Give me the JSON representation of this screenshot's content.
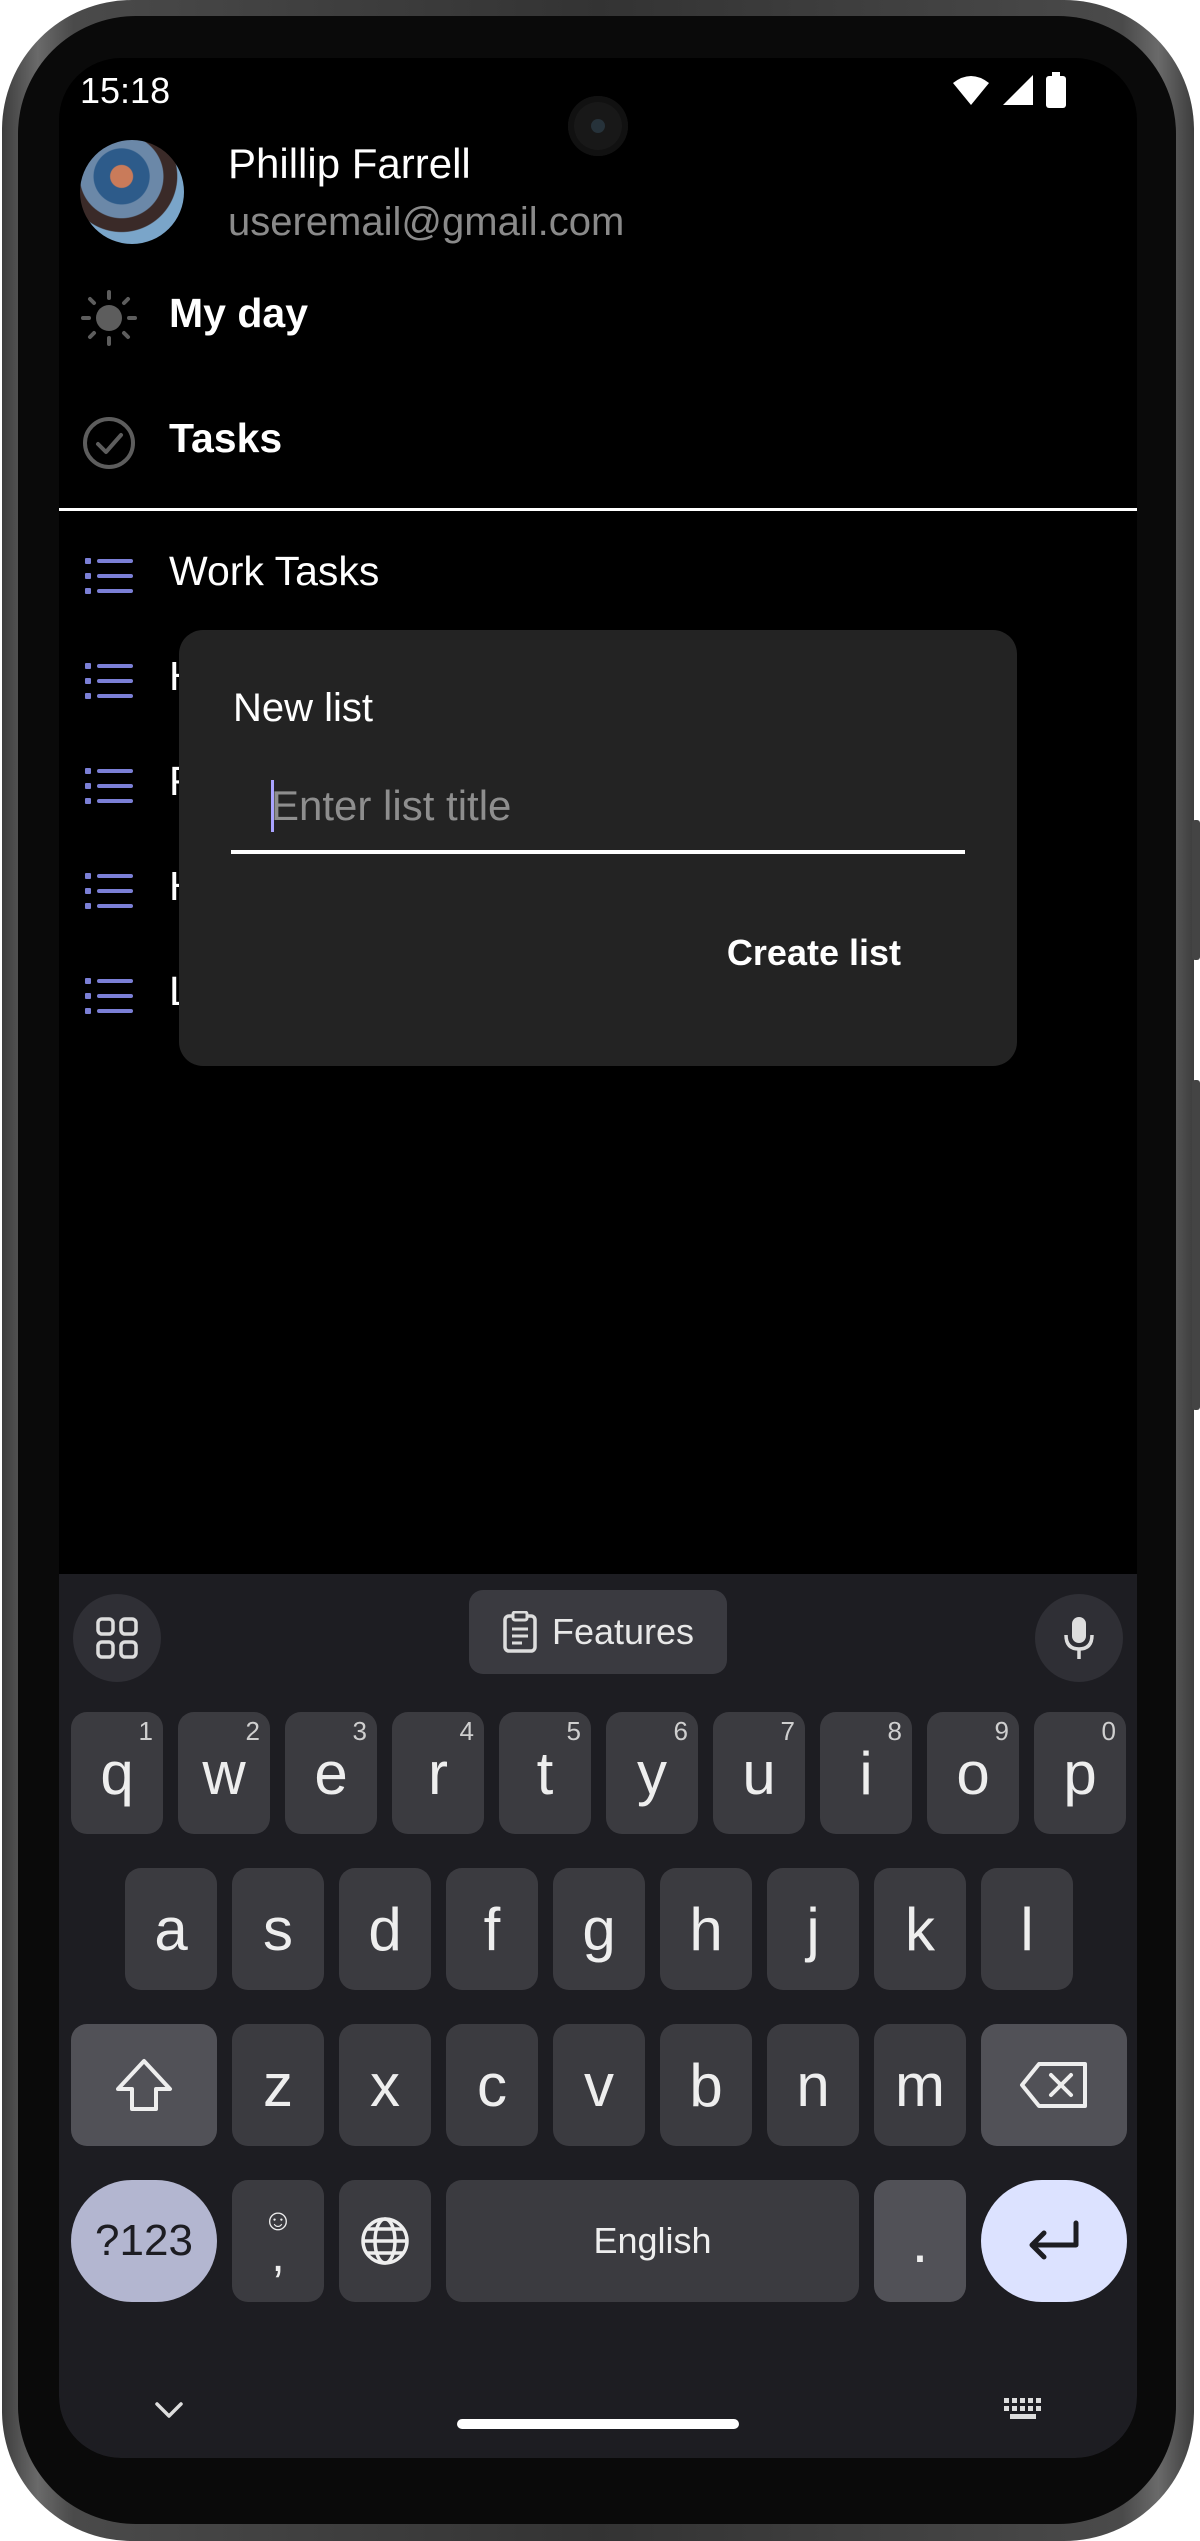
{
  "status_bar": {
    "time": "15:18"
  },
  "profile": {
    "name": "Phillip Farrell",
    "email": "useremail@gmail.com"
  },
  "nav": {
    "my_day": "My day",
    "tasks": "Tasks",
    "lists": [
      "Work Tasks",
      "H",
      "F",
      "H",
      "L"
    ]
  },
  "dialog": {
    "title": "New list",
    "input_placeholder": "Enter list title",
    "input_value": "",
    "action_label": "Create list"
  },
  "keyboard": {
    "features_label": "Features",
    "row1": [
      {
        "key": "q",
        "hint": "1"
      },
      {
        "key": "w",
        "hint": "2"
      },
      {
        "key": "e",
        "hint": "3"
      },
      {
        "key": "r",
        "hint": "4"
      },
      {
        "key": "t",
        "hint": "5"
      },
      {
        "key": "y",
        "hint": "6"
      },
      {
        "key": "u",
        "hint": "7"
      },
      {
        "key": "i",
        "hint": "8"
      },
      {
        "key": "o",
        "hint": "9"
      },
      {
        "key": "p",
        "hint": "0"
      }
    ],
    "row2": [
      "a",
      "s",
      "d",
      "f",
      "g",
      "h",
      "j",
      "k",
      "l"
    ],
    "row3": [
      "z",
      "x",
      "c",
      "v",
      "b",
      "n",
      "m"
    ],
    "symbols_label": "?123",
    "emoji_comma": ",",
    "space_label": "English",
    "period_label": "."
  },
  "colors": {
    "accent_list_icon": "#7b7fd6",
    "enter_key": "#dce2ff",
    "symbols_key": "#b3b6d0"
  }
}
